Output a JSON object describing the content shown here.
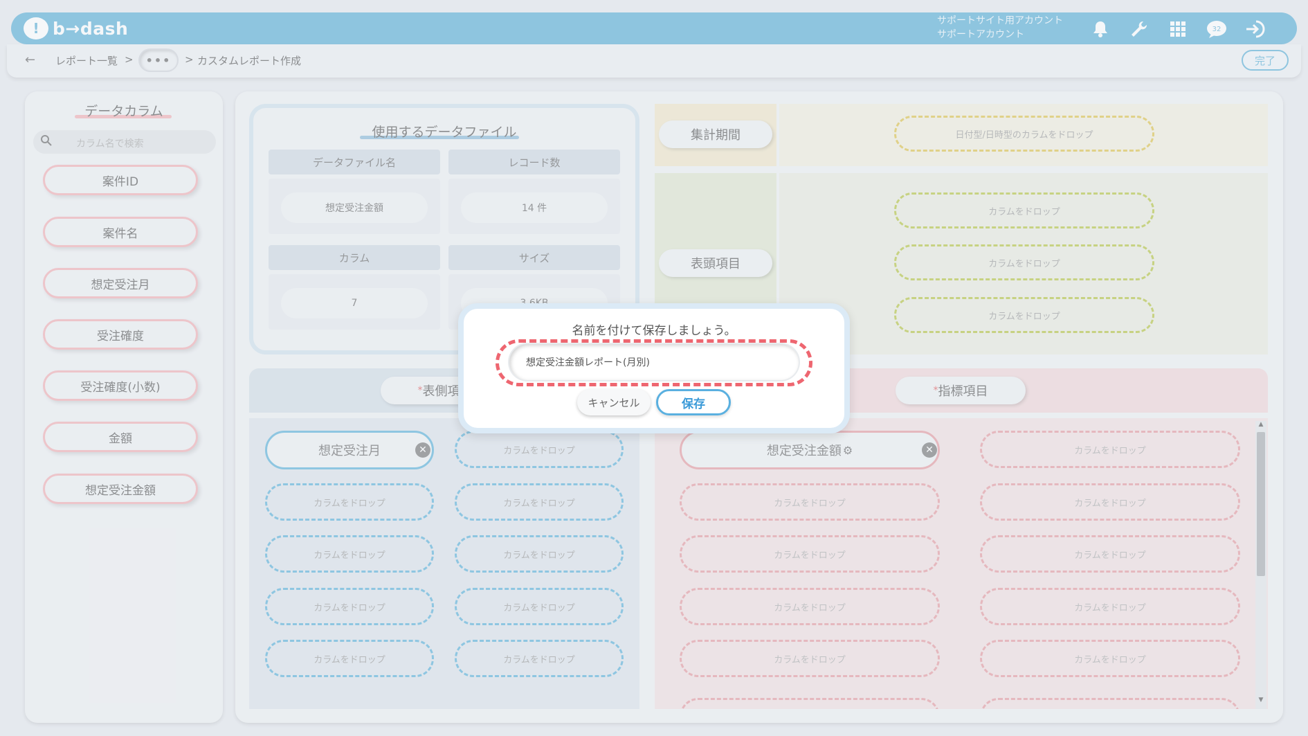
{
  "app": {
    "logo_text": "b→dash",
    "account_line1": "サポートサイト用アカウント",
    "account_line2": "サポートアカウント",
    "icons": [
      "bell-icon",
      "wrench-icon",
      "grid-icon",
      "chat-icon",
      "logout-icon"
    ],
    "accent": "#5aaed6"
  },
  "breadcrumb": {
    "back": "←",
    "item1": "レポート一覧",
    "sep": ">",
    "more": "•••",
    "item2": "カスタムレポート作成",
    "done_label": "完了"
  },
  "left_panel": {
    "title": "データカラム",
    "search_placeholder": "カラム名で検索",
    "columns": [
      "案件ID",
      "案件名",
      "想定受注月",
      "受注確度",
      "受注確度(小数)",
      "金額",
      "想定受注金額"
    ]
  },
  "data_file": {
    "title": "使用するデータファイル",
    "headers": [
      "データファイル名",
      "レコード数",
      "カラム",
      "サイズ"
    ],
    "values": [
      "想定受注金額",
      "14 件",
      "7",
      "3.6KB"
    ]
  },
  "zones": {
    "period_label": "集計期間",
    "period_drop": "日付型/日時型のカラムをドロップ",
    "header_label": "表頭項目",
    "drop": "カラムをドロップ",
    "side_label": "表側項目",
    "metric_label": "指標項目",
    "required_mark": "*",
    "side_filled": "想定受注月",
    "metric_filled": "想定受注金額",
    "close": "✕",
    "gear": "⚙"
  },
  "modal": {
    "title": "名前を付けて保存しましょう。",
    "input_value": "想定受注金額レポート(月別)",
    "cancel_label": "キャンセル",
    "save_label": "保存",
    "highlight_color": "#ee6670"
  }
}
